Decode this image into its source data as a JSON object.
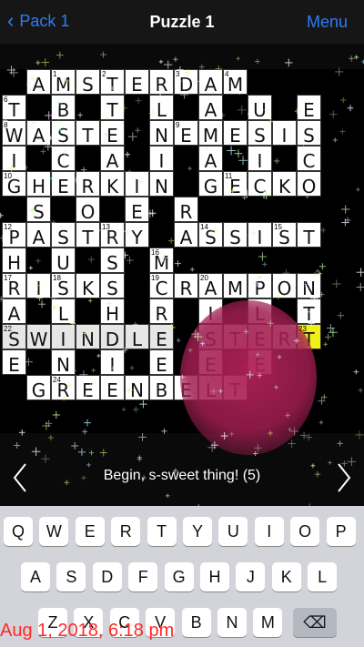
{
  "nav": {
    "back_label": "Pack 1",
    "title": "Puzzle 1",
    "menu_label": "Menu"
  },
  "grid": {
    "rows": [
      "#AMSTERDAM##",
      "T#B#T#L#A#U#E",
      "WASTE#NEMESIS",
      "I#C#A#I#A#I#C",
      "GHERKIN#GECKO",
      "#S#O#E#R",
      "PASTRY#ASSIST",
      "H#U#S#M",
      "RISKS#CRAMPON",
      "A#L#H#R#I#L#T",
      "SWINDLE#STERT",
      "E#N#I#E#E#E",
      "#GREENBELT"
    ],
    "numbers": [
      {
        "r": 0,
        "c": 2,
        "n": "1"
      },
      {
        "r": 0,
        "c": 4,
        "n": "2"
      },
      {
        "r": 0,
        "c": 7,
        "n": "3"
      },
      {
        "r": 0,
        "c": 9,
        "n": "4"
      },
      {
        "r": 0,
        "c": 11,
        "n": "5"
      },
      {
        "r": 1,
        "c": 0,
        "n": "6"
      },
      {
        "r": 1,
        "c": 13,
        "n": "7"
      },
      {
        "r": 2,
        "c": 0,
        "n": "8"
      },
      {
        "r": 2,
        "c": 7,
        "n": "9"
      },
      {
        "r": 4,
        "c": 0,
        "n": "10"
      },
      {
        "r": 4,
        "c": 9,
        "n": "11"
      },
      {
        "r": 6,
        "c": 0,
        "n": "12"
      },
      {
        "r": 6,
        "c": 4,
        "n": "13"
      },
      {
        "r": 6,
        "c": 8,
        "n": "14"
      },
      {
        "r": 6,
        "c": 11,
        "n": "15"
      },
      {
        "r": 7,
        "c": 6,
        "n": "16"
      },
      {
        "r": 8,
        "c": 0,
        "n": "17"
      },
      {
        "r": 8,
        "c": 2,
        "n": "18"
      },
      {
        "r": 8,
        "c": 6,
        "n": "19"
      },
      {
        "r": 8,
        "c": 8,
        "n": "20"
      },
      {
        "r": 8,
        "c": 13,
        "n": "21"
      },
      {
        "r": 10,
        "c": 0,
        "n": "22"
      },
      {
        "r": 10,
        "c": 12,
        "n": "23"
      },
      {
        "r": 12,
        "c": 2,
        "n": "24"
      }
    ]
  },
  "clue": {
    "text": "Begin, s-sweet thing! (5)"
  },
  "keyboard": {
    "row1": [
      "Q",
      "W",
      "E",
      "R",
      "T",
      "Y",
      "U",
      "I",
      "O",
      "P"
    ],
    "row2": [
      "A",
      "S",
      "D",
      "F",
      "G",
      "H",
      "J",
      "K",
      "L"
    ],
    "row3": [
      "Z",
      "X",
      "C",
      "V",
      "B",
      "N",
      "M"
    ],
    "backspace_symbol": "⌫"
  },
  "timestamp": "Aug 1, 2018, 6:18 pm",
  "colors": {
    "accent": "#2f7cf6",
    "highlight": "#e6e6e6",
    "selected": "#f1f015",
    "stain": "#b02158",
    "timestamp": "#ff2a2a"
  }
}
